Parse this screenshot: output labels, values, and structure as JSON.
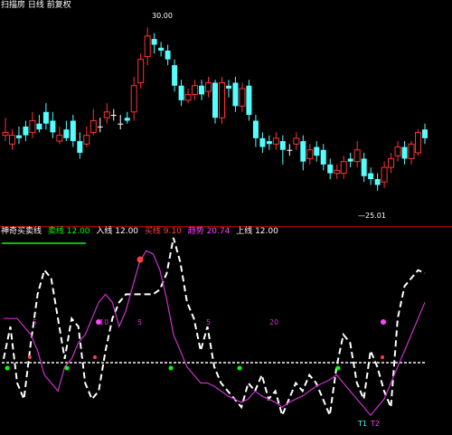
{
  "main_chart": {
    "title": "扫描房 日线 前复权",
    "high_label": "30.00",
    "low_label": "—25.01",
    "colors": {
      "up": "#ff3333",
      "down": "#54ffff",
      "flat": "#ffffff",
      "title": "#ffffff"
    }
  },
  "indicator": {
    "name": "神奇买卖线",
    "items": [
      {
        "text": "卖线 12.00",
        "color": "#00ff00"
      },
      {
        "text": "入线 12.00",
        "color": "#ffffff"
      },
      {
        "text": "买线 9.10",
        "color": "#ff4040"
      },
      {
        "text": "趋势 20.74",
        "color": "#ff44ff"
      },
      {
        "text": "上线 12.00",
        "color": "#ffffff"
      }
    ],
    "level_labels": [
      "5",
      "10",
      "5",
      "20"
    ],
    "bottom_labels": [
      "T1",
      "T2"
    ],
    "colors": {
      "main_line": "#ffffff",
      "trend_line": "#cc33cc",
      "base_line": "#bbbbbb",
      "buy": "#ff4040",
      "sell": "#00ff00",
      "mark": "#ff44ff"
    }
  },
  "chart_data": [
    {
      "type": "candlestick",
      "title": "扫描房 日线 前复权",
      "ylim": [
        24,
        31
      ],
      "candles": [
        [
          26.8,
          26.9,
          27.4,
          26.6
        ],
        [
          26.5,
          26.8,
          27.0,
          26.3
        ],
        [
          26.8,
          26.7,
          27.1,
          26.5
        ],
        [
          27.1,
          26.8,
          27.3,
          26.6
        ],
        [
          26.9,
          27.3,
          27.6,
          26.7
        ],
        [
          27.2,
          27.0,
          27.5,
          26.9
        ],
        [
          27.6,
          27.2,
          27.9,
          27.0
        ],
        [
          27.3,
          26.9,
          27.6,
          26.7
        ],
        [
          26.6,
          26.8,
          27.1,
          26.5
        ],
        [
          27.0,
          26.7,
          27.3,
          26.6
        ],
        [
          27.3,
          26.6,
          27.5,
          26.4
        ],
        [
          26.6,
          26.2,
          26.9,
          26.0
        ],
        [
          26.5,
          26.8,
          27.1,
          26.4
        ],
        [
          26.9,
          27.3,
          27.7,
          26.8
        ],
        [
          27.1,
          27.1,
          27.4,
          26.9
        ],
        [
          27.4,
          27.6,
          27.9,
          27.2
        ],
        [
          27.5,
          27.5,
          27.7,
          27.3
        ],
        [
          27.2,
          27.2,
          27.5,
          27.0
        ],
        [
          27.4,
          27.3,
          27.6,
          27.2
        ],
        [
          27.6,
          28.5,
          28.8,
          27.3
        ],
        [
          28.6,
          29.4,
          29.6,
          28.4
        ],
        [
          29.5,
          30.2,
          30.5,
          29.2
        ],
        [
          30.1,
          29.9,
          30.3,
          29.6
        ],
        [
          29.8,
          29.7,
          30.0,
          29.5
        ],
        [
          29.7,
          29.4,
          29.9,
          29.2
        ],
        [
          29.2,
          28.5,
          29.4,
          28.3
        ],
        [
          28.5,
          28.0,
          28.7,
          27.8
        ],
        [
          28.0,
          28.2,
          28.4,
          27.9
        ],
        [
          28.2,
          28.5,
          28.7,
          28.0
        ],
        [
          28.5,
          28.2,
          28.7,
          28.0
        ],
        [
          28.3,
          28.6,
          28.8,
          28.1
        ],
        [
          28.6,
          27.4,
          28.7,
          27.2
        ],
        [
          27.4,
          28.6,
          28.8,
          27.2
        ],
        [
          28.5,
          28.4,
          28.7,
          28.1
        ],
        [
          28.6,
          27.8,
          28.8,
          27.6
        ],
        [
          27.8,
          28.4,
          28.6,
          27.6
        ],
        [
          28.5,
          27.5,
          28.7,
          27.3
        ],
        [
          27.3,
          26.7,
          27.5,
          26.4
        ],
        [
          26.7,
          26.4,
          26.9,
          26.2
        ],
        [
          26.6,
          26.5,
          26.8,
          26.3
        ],
        [
          26.5,
          26.7,
          26.9,
          26.3
        ],
        [
          26.6,
          26.3,
          26.8,
          25.8
        ],
        [
          26.3,
          26.3,
          26.5,
          26.1
        ],
        [
          26.5,
          26.7,
          26.9,
          26.3
        ],
        [
          26.6,
          25.9,
          26.8,
          25.6
        ],
        [
          26.0,
          26.3,
          26.5,
          25.8
        ],
        [
          26.4,
          26.1,
          26.6,
          25.9
        ],
        [
          26.3,
          25.8,
          26.5,
          25.6
        ],
        [
          25.8,
          25.5,
          26.0,
          25.3
        ],
        [
          25.5,
          25.6,
          25.8,
          25.3
        ],
        [
          25.5,
          25.9,
          26.1,
          25.3
        ],
        [
          26.0,
          25.9,
          26.2,
          25.7
        ],
        [
          25.9,
          26.3,
          26.6,
          25.7
        ],
        [
          26.0,
          25.4,
          26.2,
          25.2
        ],
        [
          25.5,
          25.3,
          25.7,
          25.1
        ],
        [
          25.3,
          25.1,
          25.5,
          24.9
        ],
        [
          25.2,
          25.7,
          25.9,
          25.0
        ],
        [
          25.7,
          26.0,
          26.2,
          25.5
        ],
        [
          26.1,
          26.4,
          26.6,
          25.9
        ],
        [
          26.4,
          26.0,
          26.6,
          25.8
        ],
        [
          26.0,
          26.5,
          26.6,
          25.8
        ],
        [
          26.2,
          26.9,
          27.0,
          26.1
        ],
        [
          27.0,
          26.7,
          27.2,
          26.5
        ]
      ]
    },
    {
      "type": "line",
      "title": "神奇买卖线",
      "ylim": [
        -10,
        110
      ],
      "series": [
        {
          "name": "入线",
          "color": "#ffffff",
          "values": [
            35,
            55,
            20,
            10,
            45,
            75,
            90,
            85,
            60,
            35,
            60,
            55,
            20,
            10,
            15,
            40,
            60,
            70,
            75,
            75,
            75,
            75,
            75,
            78,
            88,
            110,
            95,
            70,
            60,
            40,
            55,
            30,
            20,
            15,
            10,
            5,
            20,
            15,
            25,
            10,
            15,
            0,
            10,
            20,
            15,
            25,
            20,
            10,
            0,
            30,
            50,
            45,
            20,
            10,
            40,
            30,
            15,
            5,
            60,
            80,
            85,
            90,
            88
          ]
        },
        {
          "name": "趋势",
          "color": "#cc33cc",
          "values": [
            60,
            60,
            60,
            55,
            50,
            40,
            25,
            20,
            15,
            30,
            35,
            45,
            50,
            60,
            70,
            75,
            70,
            55,
            65,
            80,
            95,
            102,
            100,
            90,
            72,
            50,
            40,
            30,
            25,
            20,
            20,
            18,
            15,
            12,
            10,
            8,
            10,
            15,
            12,
            10,
            8,
            5,
            8,
            10,
            12,
            15,
            18,
            20,
            22,
            25,
            20,
            15,
            10,
            5,
            0,
            5,
            10,
            20,
            30,
            40,
            50,
            60,
            70
          ]
        }
      ]
    }
  ]
}
